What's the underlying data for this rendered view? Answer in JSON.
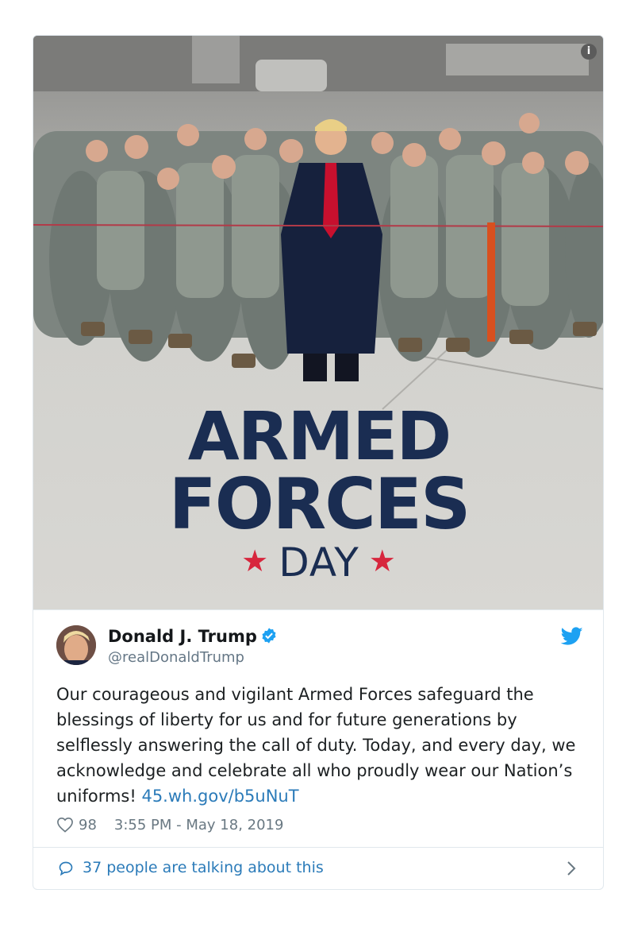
{
  "media": {
    "banner_line1": "ARMED",
    "banner_line2": "FORCES",
    "banner_line3": "DAY",
    "star": "★",
    "info_icon": "i",
    "colors": {
      "banner_text": "#1a2d52",
      "star": "#d7263d"
    }
  },
  "author": {
    "name": "Donald J. Trump",
    "handle": "@realDonaldTrump",
    "verified": true
  },
  "tweet": {
    "text": "Our courageous and vigilant Armed Forces safeguard the blessings of liberty for us and for future generations by selflessly answering the call of duty. Today, and every day, we acknowledge and celebrate all who proudly wear our Nation’s uniforms! ",
    "link": "45.wh.gov/b5uNuT"
  },
  "meta": {
    "likes": "98",
    "timestamp": "3:55 PM - May 18, 2019"
  },
  "footer": {
    "talking_label": "37 people are talking about this"
  },
  "icons": [
    "info-icon",
    "verified-badge-icon",
    "twitter-bird-icon",
    "heart-icon",
    "speech-bubble-icon",
    "chevron-right-icon"
  ],
  "colors": {
    "link": "#2b7bb9",
    "verified": "#1da1f2",
    "muted": "#697882",
    "text": "#1c2022"
  }
}
